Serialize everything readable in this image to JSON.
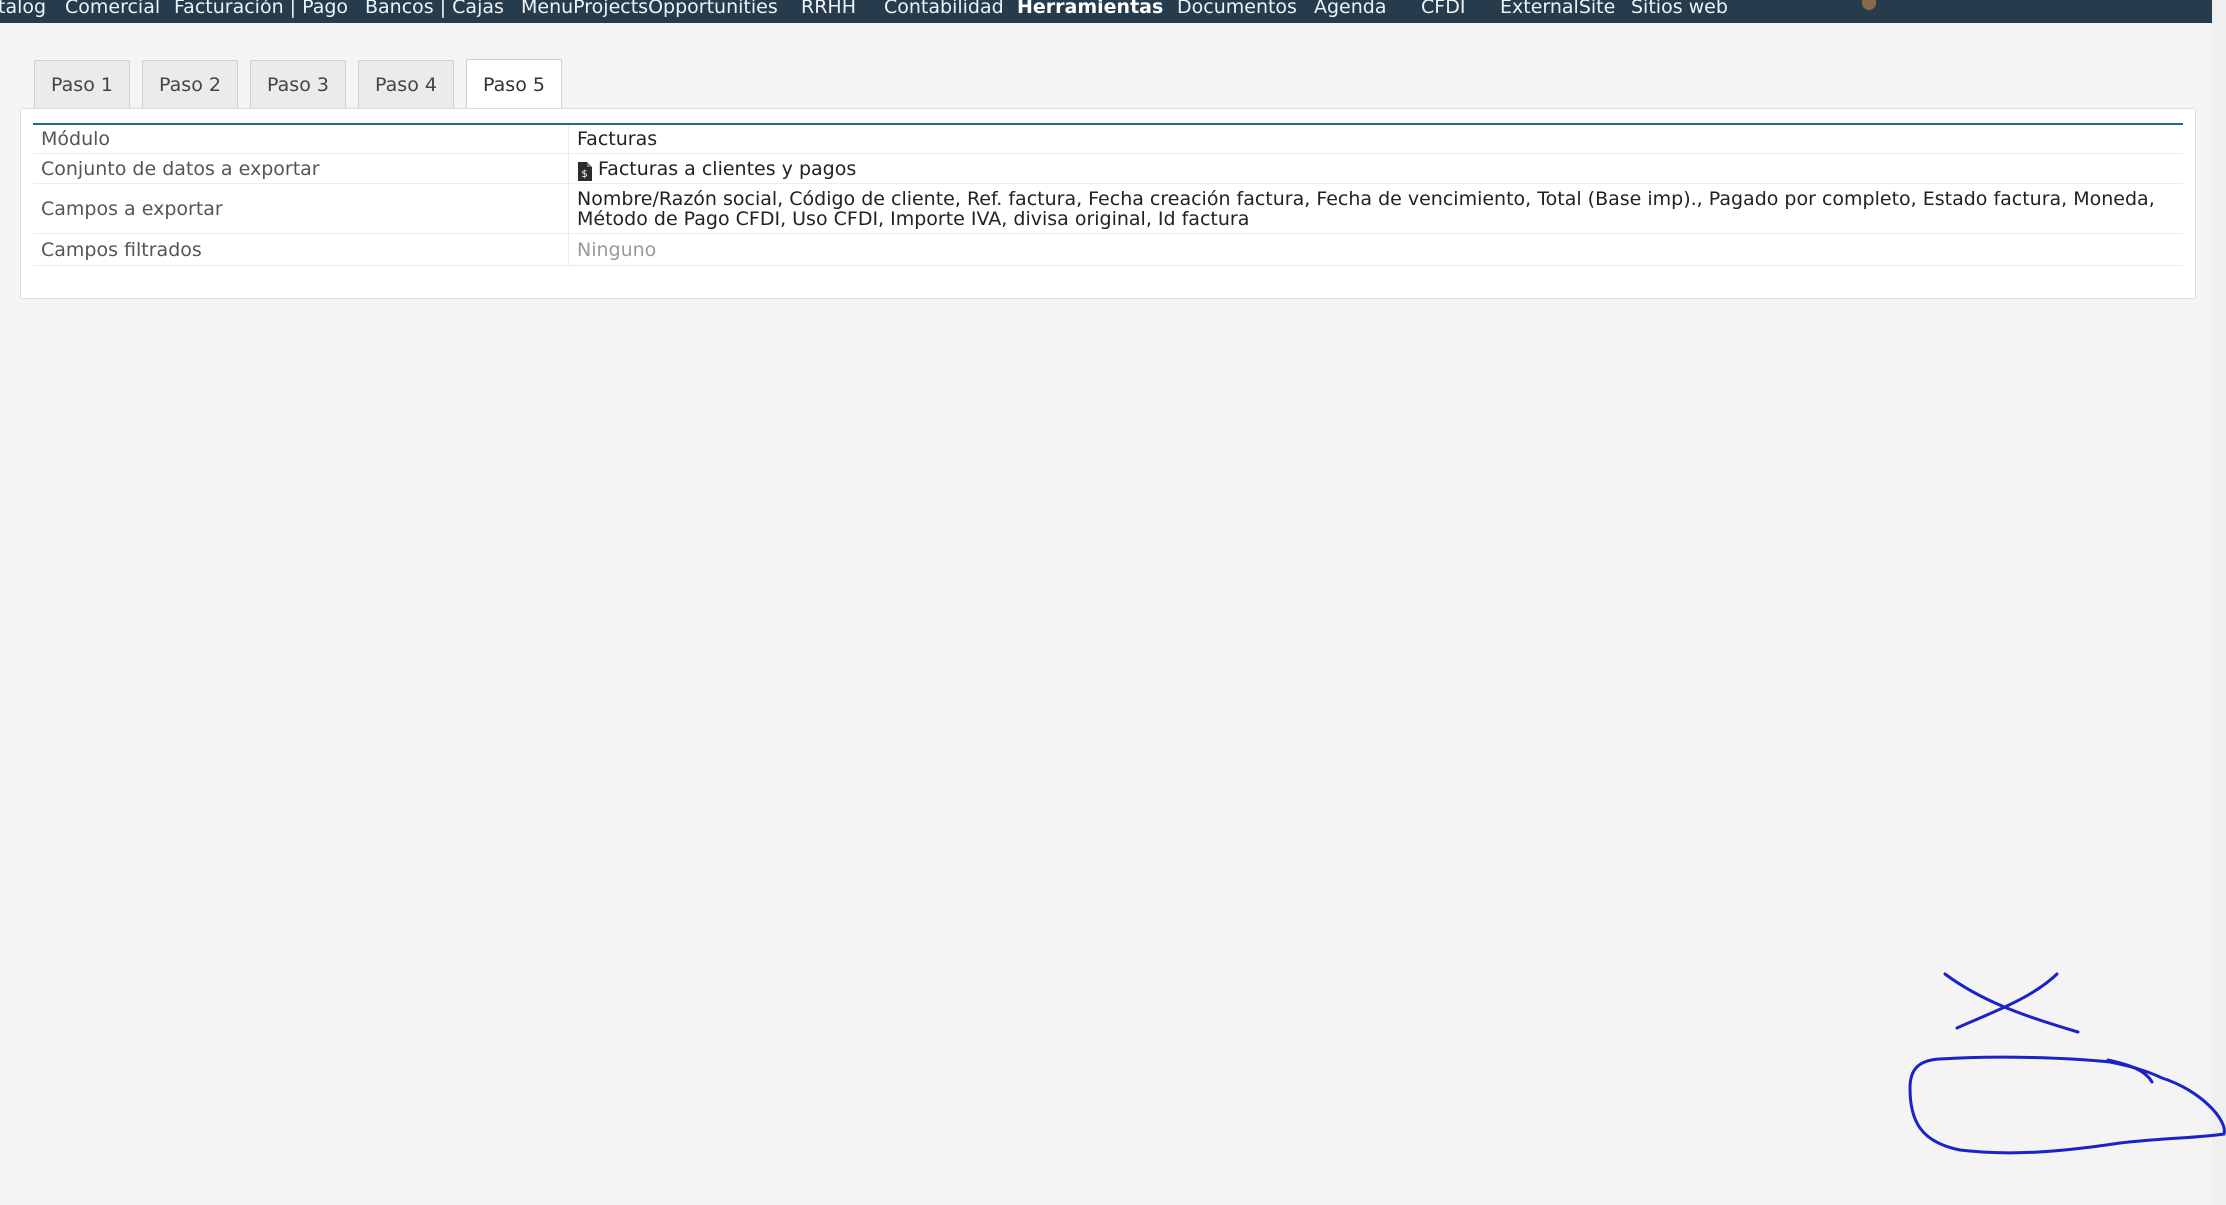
{
  "topmenu": {
    "items": [
      {
        "label": "talog"
      },
      {
        "label": "Comercial"
      },
      {
        "label": "Facturación | Pago"
      },
      {
        "label": "Bancos | Cajas"
      },
      {
        "label": "MenuProjectsOpportunities"
      },
      {
        "label": "RRHH"
      },
      {
        "label": "Contabilidad"
      },
      {
        "label": "Herramientas",
        "active": true
      },
      {
        "label": "Documentos"
      },
      {
        "label": "Agenda"
      },
      {
        "label": "CFDI"
      },
      {
        "label": "ExternalSite"
      },
      {
        "label": "Sitios web"
      }
    ]
  },
  "tabs": [
    {
      "label": "Paso 1"
    },
    {
      "label": "Paso 2"
    },
    {
      "label": "Paso 3"
    },
    {
      "label": "Paso 4"
    },
    {
      "label": "Paso 5",
      "active": true
    }
  ],
  "summary": {
    "rows": [
      {
        "label": "Módulo",
        "value": "Facturas"
      },
      {
        "label": "Conjunto de datos a exportar",
        "value": "Facturas a clientes y pagos",
        "icon": "invoice-file-icon"
      },
      {
        "label": "Campos a exportar",
        "value": "Nombre/Razón social, Código de cliente, Ref. factura, Fecha creación factura, Fecha de vencimiento, Total (Base imp)., Pagado por completo, Estado factura, Moneda, Método de Pago CFDI, Uso CFDI, Importe IVA, divisa original, Id factura"
      },
      {
        "label": "Campos filtrados",
        "value": "Ninguno"
      }
    ]
  },
  "colors": {
    "topbar": "#263c4c",
    "accent_rule": "#1f6a8f",
    "ink_annotation": "#1a22c8"
  }
}
